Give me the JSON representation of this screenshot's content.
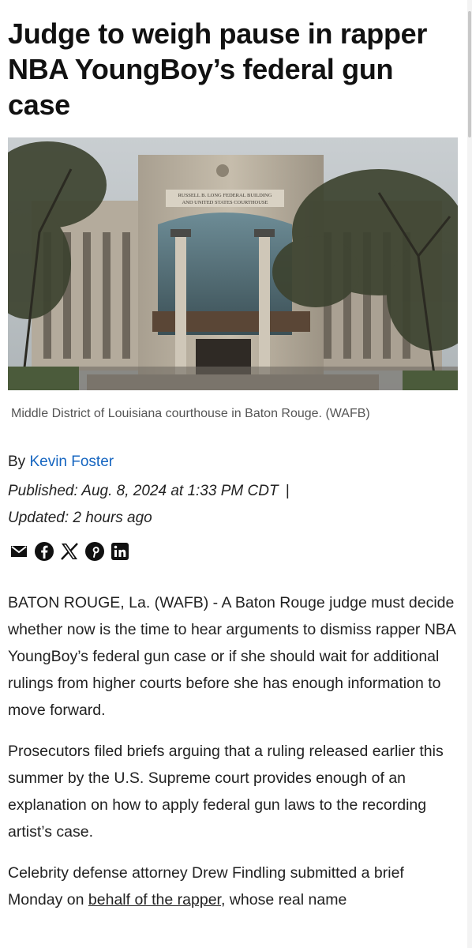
{
  "headline": "Judge to weigh pause in rapper NBA YoungBoy’s federal gun case",
  "hero_image": {
    "building_sign_line1": "RUSSELL B. LONG FEDERAL BUILDING",
    "building_sign_line2": "AND UNITED STATES COURTHOUSE"
  },
  "caption": "Middle District of Louisiana courthouse in Baton Rouge. (WAFB)",
  "byline": {
    "prefix": "By ",
    "author": "Kevin Foster"
  },
  "published": {
    "published_text": "Published: Aug. 8, 2024 at 1:33 PM CDT",
    "separator": "|",
    "updated_text": "Updated: 2 hours ago"
  },
  "share_icons": [
    "mail-icon",
    "facebook-icon",
    "x-icon",
    "pinterest-icon",
    "linkedin-icon"
  ],
  "paragraphs": {
    "p1": "BATON ROUGE, La. (WAFB) - A Baton Rouge judge must decide whether now is the time to hear arguments to dismiss rapper NBA YoungBoy’s federal gun case or if she should wait for additional rulings from higher courts before she has enough information to move forward.",
    "p2": "Prosecutors filed briefs arguing that a ruling released earlier this summer by the U.S. Supreme court provides enough of an explanation on how to apply federal gun laws to the recording artist’s case.",
    "p3_start": "Celebrity defense attorney Drew Findling submitted a brief Monday on ",
    "p3_link": "behalf of the rapper,",
    "p3_end": " whose real name"
  },
  "colors": {
    "link": "#1565c0",
    "text": "#222222",
    "caption": "#555555"
  }
}
